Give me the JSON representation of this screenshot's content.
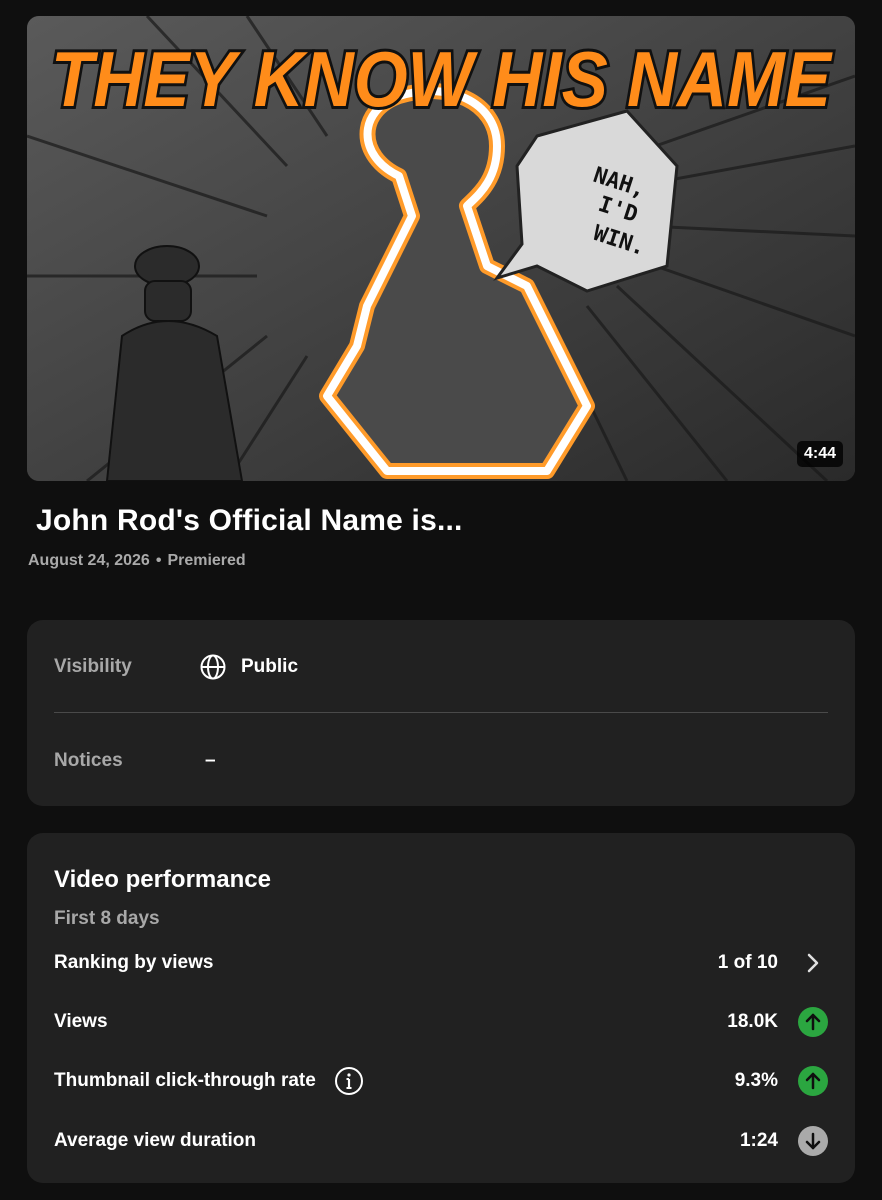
{
  "video": {
    "thumbnail_text": "THEY KNOW HIS NAME",
    "speech_bubble": [
      "NAH,",
      "I'D",
      "WIN."
    ],
    "duration": "4:44",
    "title": "John Rod's Official Name is...",
    "date": "August 24, 2026",
    "separator": "•",
    "status": "Premiered"
  },
  "status_card": {
    "visibility_label": "Visibility",
    "visibility_value": "Public",
    "visibility_icon": "globe-icon",
    "notices_label": "Notices",
    "notices_value": "–"
  },
  "performance": {
    "title": "Video performance",
    "subtitle": "First 8 days",
    "metrics": [
      {
        "label": "Ranking by views",
        "value": "1 of 10",
        "icon": "chevron-right-icon"
      },
      {
        "label": "Views",
        "value": "18.0K",
        "icon": "arrow-up-icon"
      },
      {
        "label": "Thumbnail click-through rate",
        "value": "9.3%",
        "icon": "arrow-up-icon",
        "info_icon": "info-icon"
      },
      {
        "label": "Average view duration",
        "value": "1:24",
        "icon": "arrow-down-icon"
      }
    ]
  },
  "colors": {
    "background": "#0f0f0f",
    "card": "#212121",
    "up_indicator": "#2ba640",
    "down_indicator": "#aaaaaa",
    "thumbnail_title": "#ff8c1a"
  }
}
